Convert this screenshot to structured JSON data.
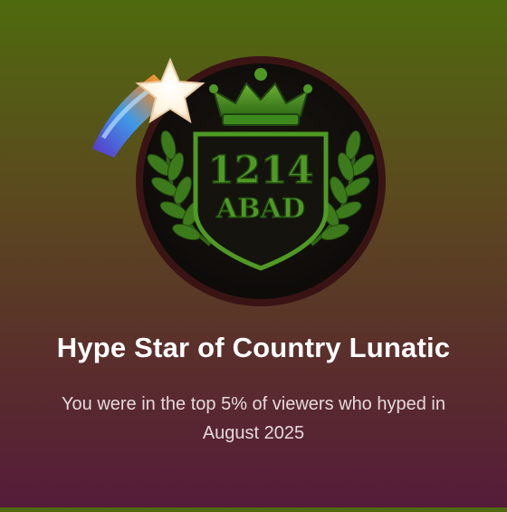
{
  "badge": {
    "emblem_top": "1214",
    "emblem_bottom": "ABAD",
    "crest_icon": "crown-shield-laurel-icon",
    "hype_icon": "shooting-star-icon"
  },
  "title": "Hype Star of Country Lunatic",
  "subtitle": "You were in the top 5% of viewers who hyped in August 2025",
  "colors": {
    "background_top": "#4f6a0e",
    "background_bottom": "#561c3a",
    "emblem_green": "#3f8a1e",
    "title_text": "#ffffff",
    "subtitle_text": "#e4d9dc"
  }
}
